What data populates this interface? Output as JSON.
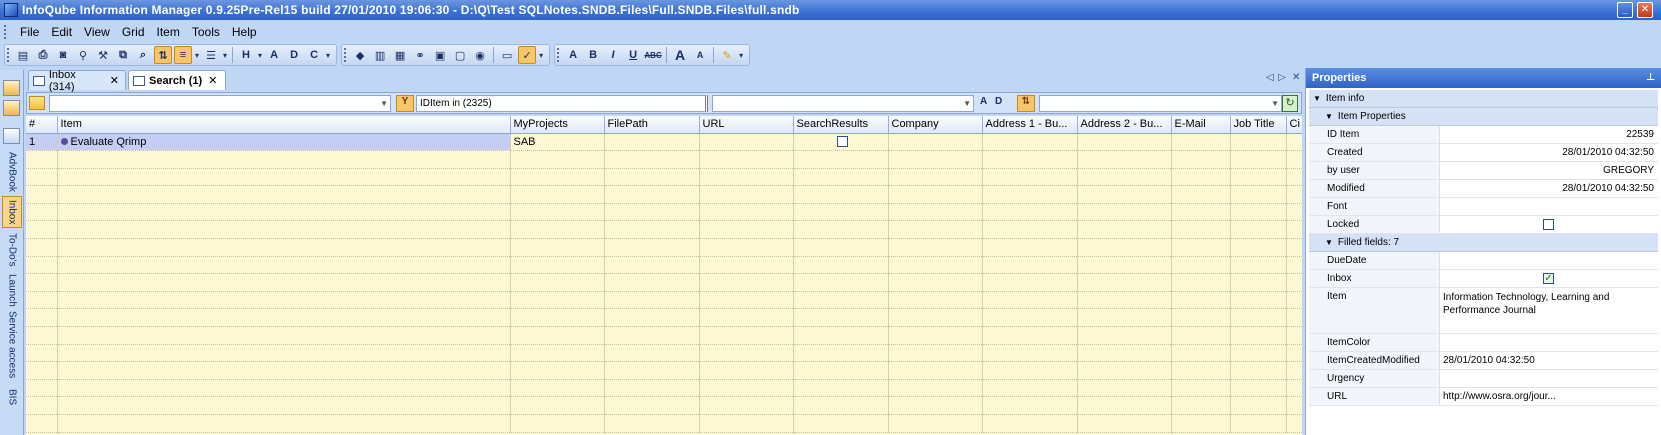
{
  "window": {
    "title": "InfoQube Information Manager 0.9.25Pre-Rel15  build 27/01/2010 19:06:30 - D:\\Q\\Test SQLNotes.SNDB.Files\\Full.SNDB.Files\\full.sndb"
  },
  "menu": {
    "items": [
      "File",
      "Edit",
      "View",
      "Grid",
      "Item",
      "Tools",
      "Help"
    ]
  },
  "left_strip": {
    "tabs": [
      "AdvBook",
      "Inbox",
      "To-Do's",
      "Launch",
      "Service access",
      "BIS"
    ],
    "active": "Inbox"
  },
  "tabs": [
    {
      "label": "Inbox (314)",
      "active": false
    },
    {
      "label": "Search (1)",
      "active": true
    }
  ],
  "filter_bar": {
    "main_combo_value": "",
    "filter_text": "IDItem in (2325)",
    "middle_combo_value": "",
    "right_combo_value": ""
  },
  "grid": {
    "columns": [
      "#",
      "Item",
      "MyProjects",
      "FilePath",
      "URL",
      "SearchResults",
      "Company",
      "Address 1 - Bu...",
      "Address 2 - Bu...",
      "E-Mail",
      "Job Title",
      "Ci"
    ],
    "rows": [
      {
        "num": "1",
        "item": "Evaluate Qrimp",
        "myprojects": "SAB",
        "filepath": "",
        "url": "",
        "searchresults": false,
        "company": "",
        "address1": "",
        "address2": "",
        "email": "",
        "jobtitle": "",
        "ci": ""
      }
    ]
  },
  "properties": {
    "title": "Properties",
    "sections": {
      "item_info": "Item info",
      "item_properties": "Item Properties",
      "filled_fields": "Filled fields: 7"
    },
    "item_properties": [
      {
        "key": "ID Item",
        "value": "22539"
      },
      {
        "key": "Created",
        "value": "28/01/2010 04:32:50"
      },
      {
        "key": "by user",
        "value": "GREGORY"
      },
      {
        "key": "Modified",
        "value": "28/01/2010 04:32:50"
      },
      {
        "key": "Font",
        "value": ""
      },
      {
        "key": "Locked",
        "checkbox": false
      }
    ],
    "filled_fields": [
      {
        "key": "DueDate",
        "value": ""
      },
      {
        "key": "Inbox",
        "checkbox": true
      },
      {
        "key": "Item",
        "value": "Information Technology, Learning and Performance Journal"
      },
      {
        "key": "ItemColor",
        "value": ""
      },
      {
        "key": "ItemCreatedModified",
        "value": "28/01/2010 04:32:50"
      },
      {
        "key": "Urgency",
        "value": ""
      },
      {
        "key": "URL",
        "value": "http://www.osra.org/jour..."
      }
    ]
  },
  "colors": {
    "accent": "#2f62c8",
    "grid_bg": "#fff8d5",
    "selected_row": "#c6cdf5",
    "active_button": "#f8c66a"
  }
}
